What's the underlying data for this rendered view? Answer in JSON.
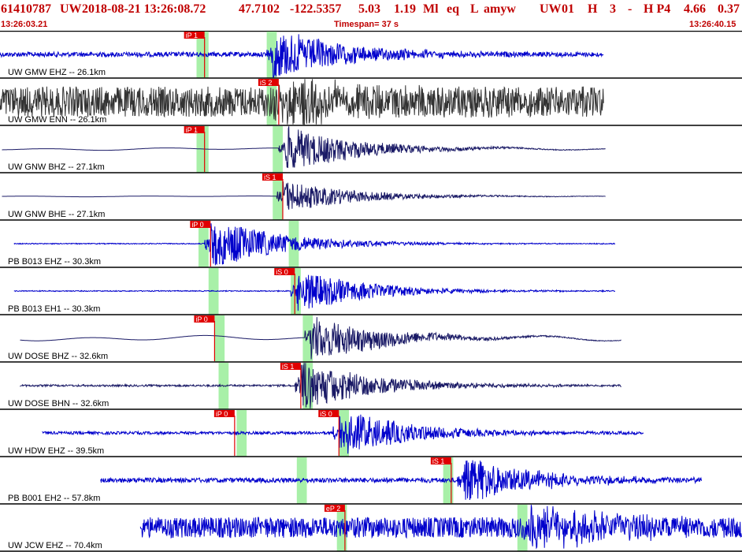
{
  "header": {
    "event_id": "61410787",
    "network": "UW",
    "origin_datetime": "2018-08-21 13:26:08.72",
    "latitude": "47.7102",
    "longitude": "-122.5357",
    "depth": "5.03",
    "magnitude": "1.19",
    "mag_type": "Ml",
    "event_type": "eq",
    "flag": "L",
    "analyst": "amyw",
    "source": "UW",
    "version": "01",
    "h_label": "H",
    "count": "3",
    "dash": "-",
    "quality": "H P4",
    "value_a": "4.66",
    "value_b": "0.37"
  },
  "subheader": {
    "start_time": "13:26:03.21",
    "timespan_label": "Timespan=  37 s",
    "end_time": "13:26:40.15"
  },
  "colors": {
    "header_red": "#c00000",
    "trace_blue": "#0000cc",
    "trace_dark": "#333333",
    "trace_navy": "#1a1a66",
    "pick_red": "#e00000",
    "window_green": "#a8f0a8"
  },
  "chart_data": {
    "type": "line",
    "time_range_s": [
      0,
      37
    ],
    "traces": [
      {
        "label": "UW GMW EHZ -- 26.1km",
        "color": "blue",
        "start_s": 0.0,
        "end_s": 30.1,
        "noise_amp": 0.05,
        "mode": "hf",
        "event_amp": 0.55,
        "picks": [
          {
            "name": "iP 1",
            "t": 10.2
          }
        ],
        "windows": [
          [
            9.8,
            10.4
          ],
          [
            13.3,
            13.8
          ]
        ],
        "event_t": 13.6
      },
      {
        "label": "UW GMW ENN -- 26.1km",
        "color": "dark",
        "start_s": 0.0,
        "end_s": 30.1,
        "noise_amp": 0.32,
        "mode": "hf",
        "event_amp": 0.45,
        "picks": [
          {
            "name": "iS 2",
            "t": 13.9
          }
        ],
        "windows": [
          [
            13.3,
            13.8
          ]
        ],
        "event_t": 13.9
      },
      {
        "label": "UW GNW BHZ -- 27.1km",
        "color": "navy",
        "start_s": 0.1,
        "end_s": 30.2,
        "noise_amp": 0.03,
        "mode": "lf",
        "event_amp": 0.5,
        "picks": [
          {
            "name": "iP 1",
            "t": 10.2
          }
        ],
        "windows": [
          [
            9.8,
            10.4
          ],
          [
            13.6,
            14.1
          ]
        ],
        "event_t": 14.2
      },
      {
        "label": "UW GNW BHE -- 27.1km",
        "color": "navy",
        "start_s": 0.1,
        "end_s": 30.2,
        "noise_amp": 0.01,
        "mode": "lf",
        "event_amp": 0.35,
        "picks": [
          {
            "name": "iS 1",
            "t": 14.1
          }
        ],
        "windows": [
          [
            13.6,
            14.1
          ]
        ],
        "event_t": 14.1
      },
      {
        "label": "PB B013 EHZ -- 30.3km",
        "color": "blue",
        "start_s": 0.7,
        "end_s": 30.7,
        "noise_amp": 0.01,
        "mode": "hf",
        "event_amp": 0.55,
        "picks": [
          {
            "name": "iP 0",
            "t": 10.5
          }
        ],
        "windows": [
          [
            9.9,
            10.4
          ],
          [
            14.4,
            14.9
          ]
        ],
        "event_t": 10.5
      },
      {
        "label": "PB B013 EH1 -- 30.3km",
        "color": "blue",
        "start_s": 0.7,
        "end_s": 30.7,
        "noise_amp": 0.01,
        "mode": "hf",
        "event_amp": 0.45,
        "picks": [
          {
            "name": "iS 0",
            "t": 14.7
          }
        ],
        "windows": [
          [
            10.4,
            10.9
          ],
          [
            14.5,
            15.0
          ]
        ],
        "event_t": 14.8
      },
      {
        "label": "UW DOSE BHZ -- 32.6km",
        "color": "navy",
        "start_s": 1.0,
        "end_s": 31.0,
        "noise_amp": 0.06,
        "mode": "lf",
        "event_amp": 0.5,
        "picks": [
          {
            "name": "iP 0",
            "t": 10.7
          }
        ],
        "windows": [
          [
            10.7,
            11.2
          ],
          [
            15.1,
            15.6
          ]
        ],
        "event_t": 15.5
      },
      {
        "label": "UW DOSE BHN -- 32.6km",
        "color": "navy",
        "start_s": 1.0,
        "end_s": 31.0,
        "noise_amp": 0.02,
        "mode": "hf",
        "event_amp": 0.55,
        "picks": [
          {
            "name": "iS 1",
            "t": 15.0
          }
        ],
        "windows": [
          [
            10.9,
            11.4
          ],
          [
            15.1,
            15.6
          ]
        ],
        "event_t": 15.0
      },
      {
        "label": "UW HDW EHZ -- 39.5km",
        "color": "blue",
        "start_s": 2.1,
        "end_s": 32.1,
        "noise_amp": 0.03,
        "mode": "hf",
        "event_amp": 0.5,
        "picks": [
          {
            "name": "iP 0",
            "t": 11.7
          },
          {
            "name": "iS 0",
            "t": 16.9
          }
        ],
        "windows": [
          [
            11.8,
            12.3
          ],
          [
            16.9,
            17.4
          ]
        ],
        "event_t": 16.9
      },
      {
        "label": "PB B001 EH2 -- 57.8km",
        "color": "blue",
        "start_s": 5.0,
        "end_s": 35.0,
        "noise_amp": 0.05,
        "mode": "hf",
        "event_amp": 0.5,
        "picks": [
          {
            "name": "iS 1",
            "t": 22.5
          }
        ],
        "windows": [
          [
            14.8,
            15.3
          ],
          [
            22.1,
            22.6
          ]
        ],
        "event_t": 23.1
      },
      {
        "label": "UW JCW EHZ -- 70.4km",
        "color": "blue",
        "start_s": 7.0,
        "end_s": 37.0,
        "noise_amp": 0.22,
        "mode": "hf",
        "event_amp": 0.5,
        "picks": [
          {
            "name": "eP 2",
            "t": 17.2
          }
        ],
        "windows": [
          [
            16.8,
            17.3
          ],
          [
            25.8,
            26.3
          ]
        ],
        "event_t": 26.4
      }
    ]
  }
}
